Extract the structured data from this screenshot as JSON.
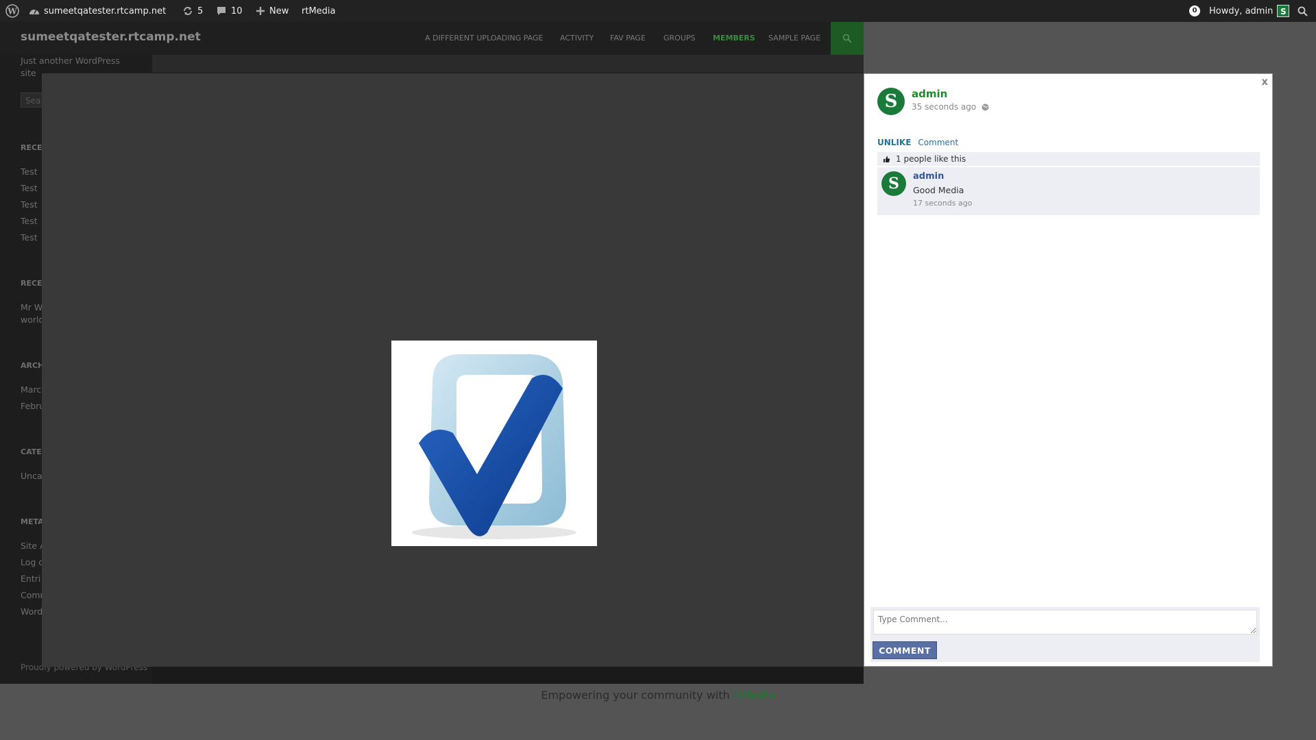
{
  "adminbar": {
    "site_name": "sumeetqatester.rtcamp.net",
    "updates_count": "5",
    "comments_count": "10",
    "new_label": "New",
    "rtmedia_label": "rtMedia",
    "notif_count": "0",
    "howdy": "Howdy, admin"
  },
  "site": {
    "title": "sumeetqatester.rtcamp.net",
    "tagline": "Just another WordPress site",
    "search_placeholder": "Sea",
    "nav": [
      "A DIFFERENT UPLOADING PAGE",
      "ACTIVITY",
      "FAV PAGE",
      "GROUPS",
      "MEMBERS",
      "SAMPLE PAGE"
    ],
    "sidebar": {
      "recent_posts_heading": "RECE",
      "recent_posts": [
        "Test",
        "Test",
        "Test",
        "Test",
        "Test"
      ],
      "recent_comments_heading": "RECE",
      "recent_comment_line1": "Mr W",
      "recent_comment_line2": "world",
      "archives_heading": "ARCH",
      "archives": [
        "Marc",
        "Febru"
      ],
      "categories_heading": "CATE",
      "categories": [
        "Unca"
      ],
      "meta_heading": "META",
      "meta": [
        "Site A",
        "Log o",
        "Entri",
        "Comm",
        "Word"
      ]
    },
    "footer": "Proudly powered by WordPress"
  },
  "lightbox": {
    "close_label": "x",
    "author": "admin",
    "avatar_letter": "S",
    "posted_time": "35 seconds ago",
    "unlike_label": "UNLIKE",
    "comment_link_label": "Comment",
    "likes_text": "1 people like this",
    "comments": [
      {
        "author": "admin",
        "text": "Good Media",
        "time": "17 seconds ago"
      }
    ],
    "comment_placeholder": "Type Comment...",
    "comment_button": "COMMENT"
  },
  "footer_bar": {
    "prefix": "Empowering your community with ",
    "brand": "rtMedia"
  },
  "colors": {
    "accent_green": "#1f8a2a",
    "link_blue": "#21759b",
    "button_blue": "#5a6fa3"
  }
}
